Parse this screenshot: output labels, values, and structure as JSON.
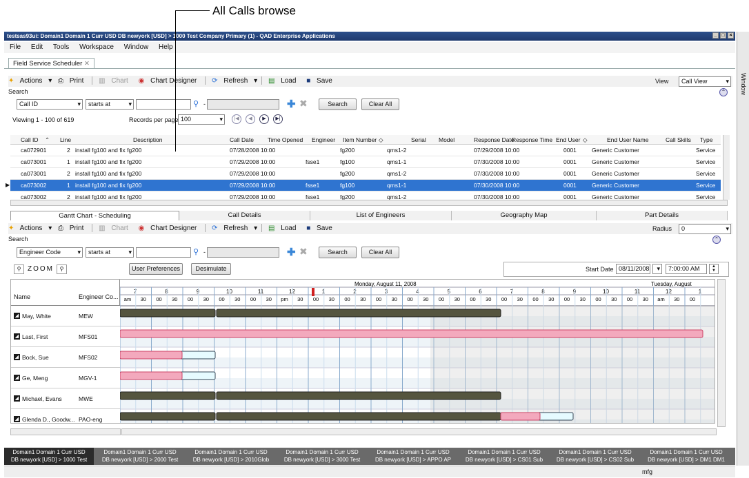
{
  "annotation": {
    "label": "All Calls browse"
  },
  "window": {
    "title": "testsas93ui: Domain1 Domain 1 Curr USD DB newyork [USD] > 1000 Test Company Primary (1) - QAD Enterprise Applications"
  },
  "menu": [
    "File",
    "Edit",
    "Tools",
    "Workspace",
    "Window",
    "Help"
  ],
  "tab": {
    "label": "Field Service Scheduler"
  },
  "toolbar": {
    "actions": "Actions",
    "print": "Print",
    "chart": "Chart",
    "chart_designer": "Chart Designer",
    "refresh": "Refresh",
    "load": "Load",
    "save": "Save",
    "view_label": "View",
    "view_value": "Call View",
    "radius_label": "Radius",
    "radius_value": "0"
  },
  "search": {
    "section_label": "Search",
    "field1": "Call ID",
    "op1": "starts at",
    "search_btn": "Search",
    "clear_btn": "Clear All",
    "field2": "Engineer Code",
    "op2": "starts at"
  },
  "paging": {
    "viewing": "Viewing 1 - 100 of 619",
    "records_label": "Records per page",
    "records_value": "100"
  },
  "grid": {
    "headers": [
      "Call ID",
      "Line",
      "Description",
      "Call Date",
      "Time Opened",
      "Engineer",
      "Item Number",
      "Serial",
      "Model",
      "Response Date",
      "Response Time",
      "End User",
      "End User Name",
      "Call Skills",
      "Type"
    ],
    "rows": [
      {
        "call_id": "ca072901",
        "line": "2",
        "desc": "install fg100 and fix fg200",
        "date": "07/28/2008 10:00",
        "engineer": "",
        "item": "fg200",
        "serial": "qms1-2",
        "resp": "07/29/2008 10:00",
        "enduser": "0001",
        "enduser_name": "Generic Customer",
        "type": "Service"
      },
      {
        "call_id": "ca073001",
        "line": "1",
        "desc": "install fg100 and fix fg200",
        "date": "07/29/2008 10:00",
        "engineer": "fsse1",
        "item": "fg100",
        "serial": "qms1-1",
        "resp": "07/30/2008 10:00",
        "enduser": "0001",
        "enduser_name": "Generic Customer",
        "type": "Service"
      },
      {
        "call_id": "ca073001",
        "line": "2",
        "desc": "install fg100 and fix fg200",
        "date": "07/29/2008 10:00",
        "engineer": "",
        "item": "fg200",
        "serial": "qms1-2",
        "resp": "07/30/2008 10:00",
        "enduser": "0001",
        "enduser_name": "Generic Customer",
        "type": "Service"
      },
      {
        "call_id": "ca073002",
        "line": "1",
        "desc": "install fg100 and fix fg200",
        "date": "07/29/2008 10:00",
        "engineer": "fsse1",
        "item": "fg100",
        "serial": "qms1-1",
        "resp": "07/30/2008 10:00",
        "enduser": "0001",
        "enduser_name": "Generic Customer",
        "type": "Service"
      },
      {
        "call_id": "ca073002",
        "line": "2",
        "desc": "install fg100 and fix fg200",
        "date": "07/29/2008 10:00",
        "engineer": "fsse1",
        "item": "fg200",
        "serial": "qms1-2",
        "resp": "07/30/2008 10:00",
        "enduser": "0001",
        "enduser_name": "Generic Customer",
        "type": "Service"
      }
    ]
  },
  "subtabs": [
    "Gantt Chart - Scheduling",
    "Call Details",
    "List of Engineers",
    "Geography Map",
    "Part Details"
  ],
  "gantt": {
    "zoom_label": "ZOOM",
    "user_prefs": "User Preferences",
    "desimulate": "Desimulate",
    "start_date_label": "Start Date",
    "start_date": "08/11/2008",
    "start_time": "7:00:00 AM",
    "day1": "Monday, August 11, 2008",
    "day2": "Tuesday, August",
    "col_name": "Name",
    "col_code": "Engineer Co...",
    "hours": [
      "7",
      "8",
      "9",
      "10",
      "11",
      "12",
      "1",
      "2",
      "3",
      "4",
      "5",
      "6",
      "7",
      "8",
      "9",
      "10",
      "11",
      "12",
      "1"
    ],
    "sub1": [
      "am",
      "30",
      "00",
      "30",
      "00",
      "30",
      "00",
      "30",
      "00",
      "30",
      "pm",
      "30",
      "00",
      "30",
      "00",
      "30",
      "00",
      "30",
      "00",
      "30",
      "00",
      "30",
      "00",
      "30",
      "00",
      "30",
      "00",
      "30",
      "00",
      "30",
      "00",
      "30",
      "00",
      "30",
      "am",
      "30",
      "00"
    ],
    "engineers": [
      {
        "name": "May, White",
        "code": "MEW"
      },
      {
        "name": "Last, First",
        "code": "MFS01"
      },
      {
        "name": "Bock, Sue",
        "code": "MFS02"
      },
      {
        "name": "Ge, Meng",
        "code": "MGV-1"
      },
      {
        "name": "Michael, Evans",
        "code": "MWE"
      },
      {
        "name": "Glenda D., Goodw...",
        "code": "PAO-eng"
      }
    ]
  },
  "status_tabs": [
    [
      "Domain1 Domain 1 Curr USD",
      "DB newyork [USD] > 1000 Test"
    ],
    [
      "Domain1 Domain 1 Curr USD",
      "DB newyork [USD] > 2000 Test"
    ],
    [
      "Domain1 Domain 1 Curr USD",
      "DB newyork [USD] > 2010Glob"
    ],
    [
      "Domain1 Domain 1 Curr USD",
      "DB newyork [USD] > 3000 Test"
    ],
    [
      "Domain1 Domain 1 Curr USD",
      "DB newyork [USD] > APPO AP"
    ],
    [
      "Domain1 Domain 1 Curr USD",
      "DB newyork [USD] > CS01 Sub"
    ],
    [
      "Domain1 Domain 1 Curr USD",
      "DB newyork [USD] > CS02 Sub"
    ],
    [
      "Domain1 Domain 1 Curr USD",
      "DB newyork [USD] > DM1 DM1"
    ]
  ],
  "footer": {
    "user": "mfg"
  },
  "right_pane": {
    "label": "Window"
  }
}
